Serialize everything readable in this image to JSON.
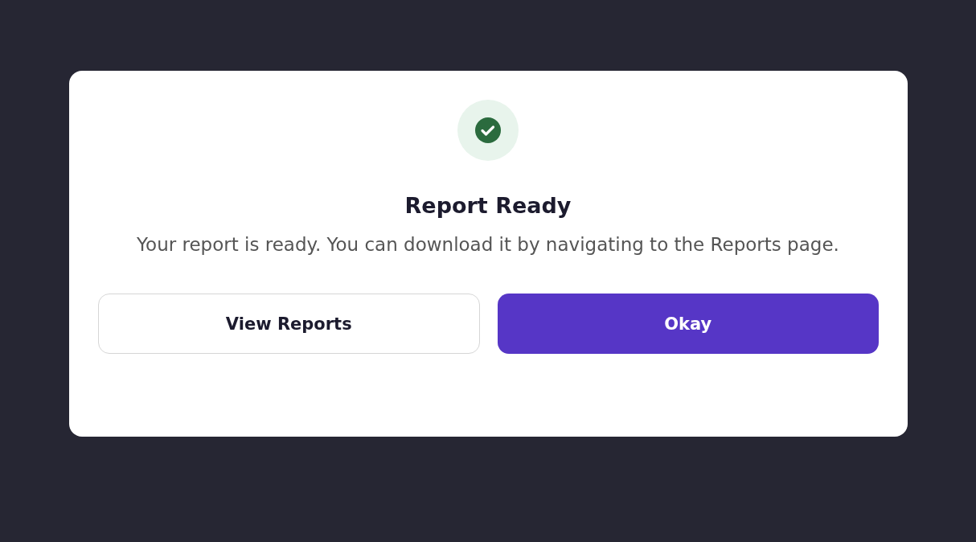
{
  "dialog": {
    "title": "Report Ready",
    "message": "Your report is ready. You can download it by navigating to the Reports page.",
    "buttons": [
      {
        "label": "View Reports",
        "kind": "secondary"
      },
      {
        "label": "Okay",
        "kind": "primary"
      }
    ]
  }
}
